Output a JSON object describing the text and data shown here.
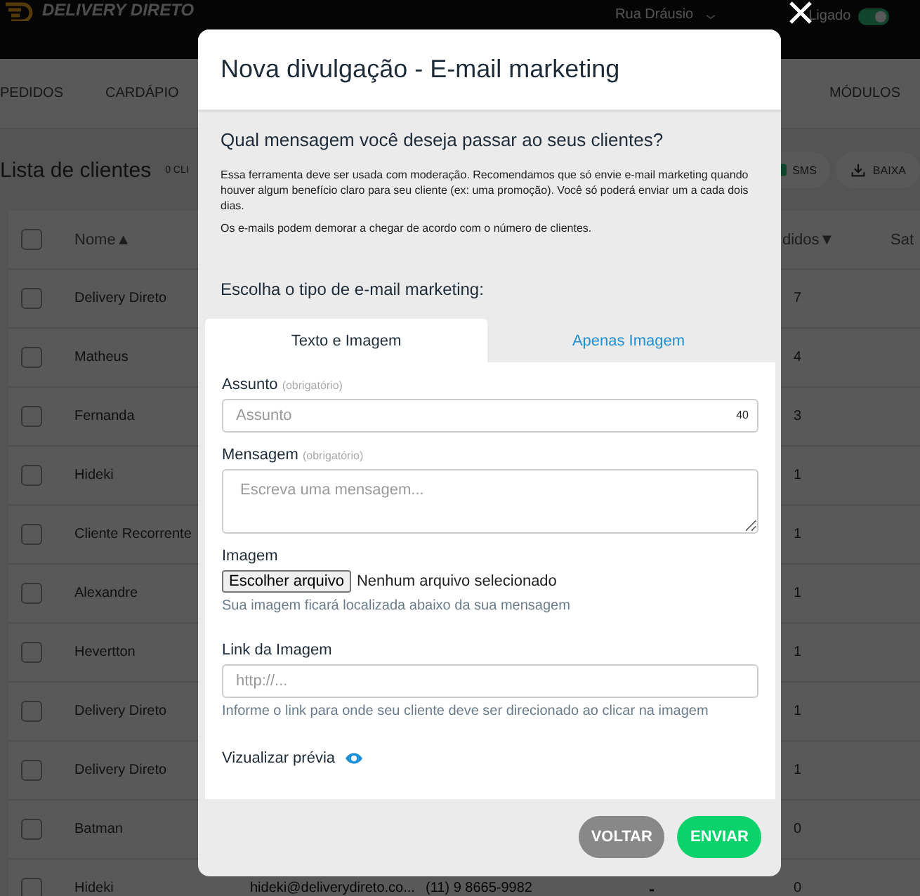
{
  "header": {
    "logo": "DELIVERY DIRETO",
    "store": "Rua Dráusio",
    "status_label": "Ligado",
    "status_on": true
  },
  "nav": [
    "PEDIDOS",
    "CARDÁPIO",
    "MÓDULOS"
  ],
  "page": {
    "title": "Lista de clientes",
    "count": "0 CLI",
    "actions": [
      {
        "label": "SMS",
        "kind": "sms"
      },
      {
        "label": "BAIXA",
        "kind": "download"
      }
    ]
  },
  "table": {
    "all_checked": false,
    "columns": [
      {
        "label": "Nome",
        "sort": "▲"
      },
      {
        "label": "didos",
        "sort": "▼"
      },
      {
        "label": "Sat"
      }
    ],
    "rows": [
      {
        "name": "Delivery Direto",
        "orders": "7",
        "checked": false
      },
      {
        "name": "Matheus",
        "orders": "4",
        "checked": false
      },
      {
        "name": "Fernanda",
        "orders": "3",
        "checked": false
      },
      {
        "name": "Hideki",
        "orders": "1",
        "checked": false
      },
      {
        "name": "Cliente Recorrente",
        "orders": "1",
        "checked": false
      },
      {
        "name": "Alexandre",
        "orders": "1",
        "checked": false
      },
      {
        "name": "Hevertton",
        "orders": "1",
        "checked": false
      },
      {
        "name": "Delivery Direto",
        "orders": "1",
        "checked": false
      },
      {
        "name": "Delivery Direto",
        "orders": "1",
        "checked": false
      },
      {
        "name": "Batman",
        "orders": "0",
        "checked": false
      },
      {
        "name": "Hideki",
        "email": "hideki@deliverydireto.co...",
        "phone": "(11) 9 8665-9982",
        "column_5": "-",
        "orders": "0",
        "checked": false
      }
    ]
  },
  "modal": {
    "title": "Nova divulgação - E-mail marketing",
    "question": "Qual mensagem você deseja passar ao seus clientes?",
    "notes": [
      "Essa ferramenta deve ser usada com moderação. Recomendamos que só envie e-mail marketing quando houver algum benefício claro para seu cliente (ex: uma promoção). Você só poderá enviar um a cada dois dias.",
      "Os e-mails podem demorar a chegar de acordo com o número de clientes."
    ],
    "choose_label": "Escolha o tipo de e-mail marketing:",
    "tabs": [
      {
        "label": "Texto e Imagem",
        "selected": true
      },
      {
        "label": "Apenas Imagem",
        "selected": false
      }
    ],
    "subject": {
      "label": "Assunto",
      "hint": "(obrigatório)",
      "placeholder": "Assunto",
      "counter": "40"
    },
    "message": {
      "label": "Mensagem",
      "hint": "(obrigatório)",
      "placeholder": "Escreva uma mensagem..."
    },
    "image": {
      "label": "Imagem",
      "button": "Escolher arquivo",
      "status": "Nenhum arquivo selecionado",
      "help": "Sua imagem ficará localizada abaixo da sua mensagem"
    },
    "link": {
      "label": "Link da Imagem",
      "placeholder": "http://...",
      "help": "Informe o link para onde seu cliente deve ser direcionado ao clicar na imagem"
    },
    "preview": "Vizualizar prévia",
    "buttons": [
      {
        "label": "VOLTAR",
        "kind": "back"
      },
      {
        "label": "ENVIAR",
        "kind": "send"
      }
    ]
  }
}
